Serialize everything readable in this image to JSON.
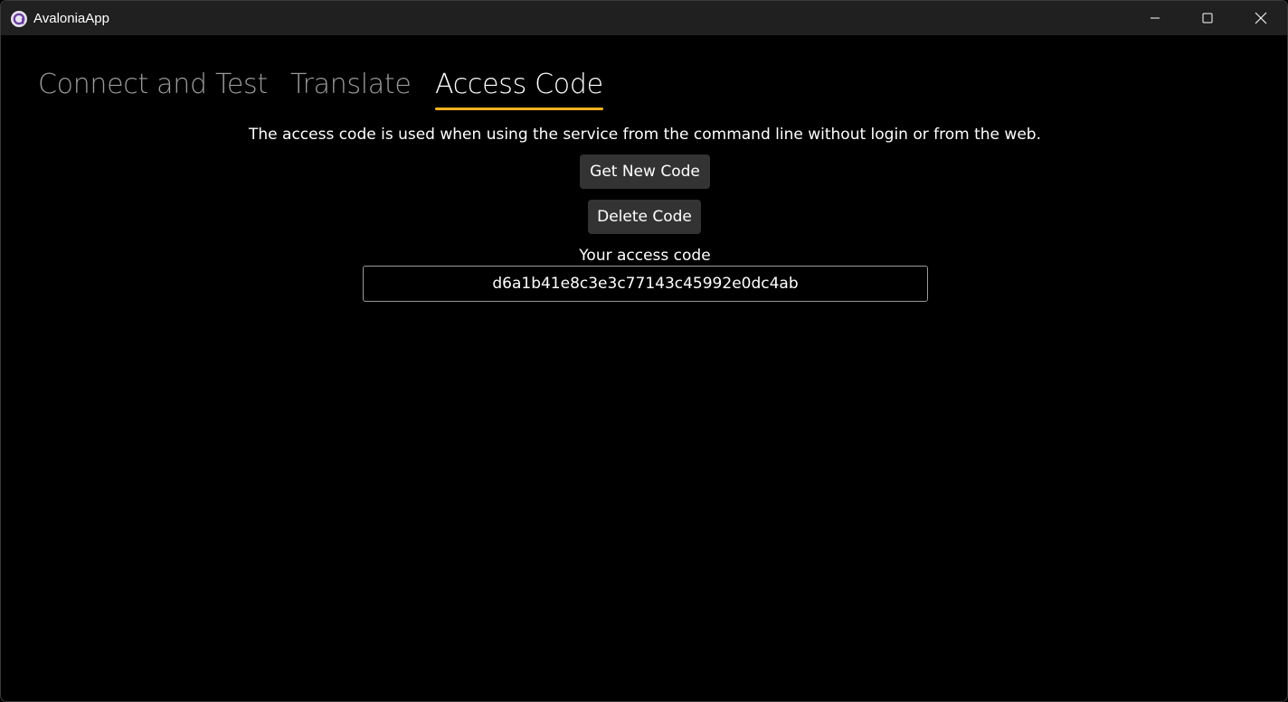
{
  "window": {
    "title": "AvaloniaApp",
    "icon": "avalonia-logo-icon",
    "controls": {
      "minimize_icon": "minimize-icon",
      "maximize_icon": "maximize-icon",
      "close_icon": "close-icon"
    }
  },
  "tabs": [
    {
      "label": "Connect and Test",
      "selected": false
    },
    {
      "label": "Translate",
      "selected": false
    },
    {
      "label": "Access Code",
      "selected": true
    }
  ],
  "access_code_page": {
    "description": "The access code is used when using the service from the command line without login or from the web.",
    "get_new_code_label": "Get New Code",
    "delete_code_label": "Delete Code",
    "code_label": "Your access code",
    "code_value": "d6a1b41e8c3e3c77143c45992e0dc4ab"
  },
  "colors": {
    "background": "#000000",
    "titlebar": "#202020",
    "accent_underline": "#f5b21c",
    "button_bg": "#333333",
    "inactive_tab": "#9a9a9a"
  }
}
